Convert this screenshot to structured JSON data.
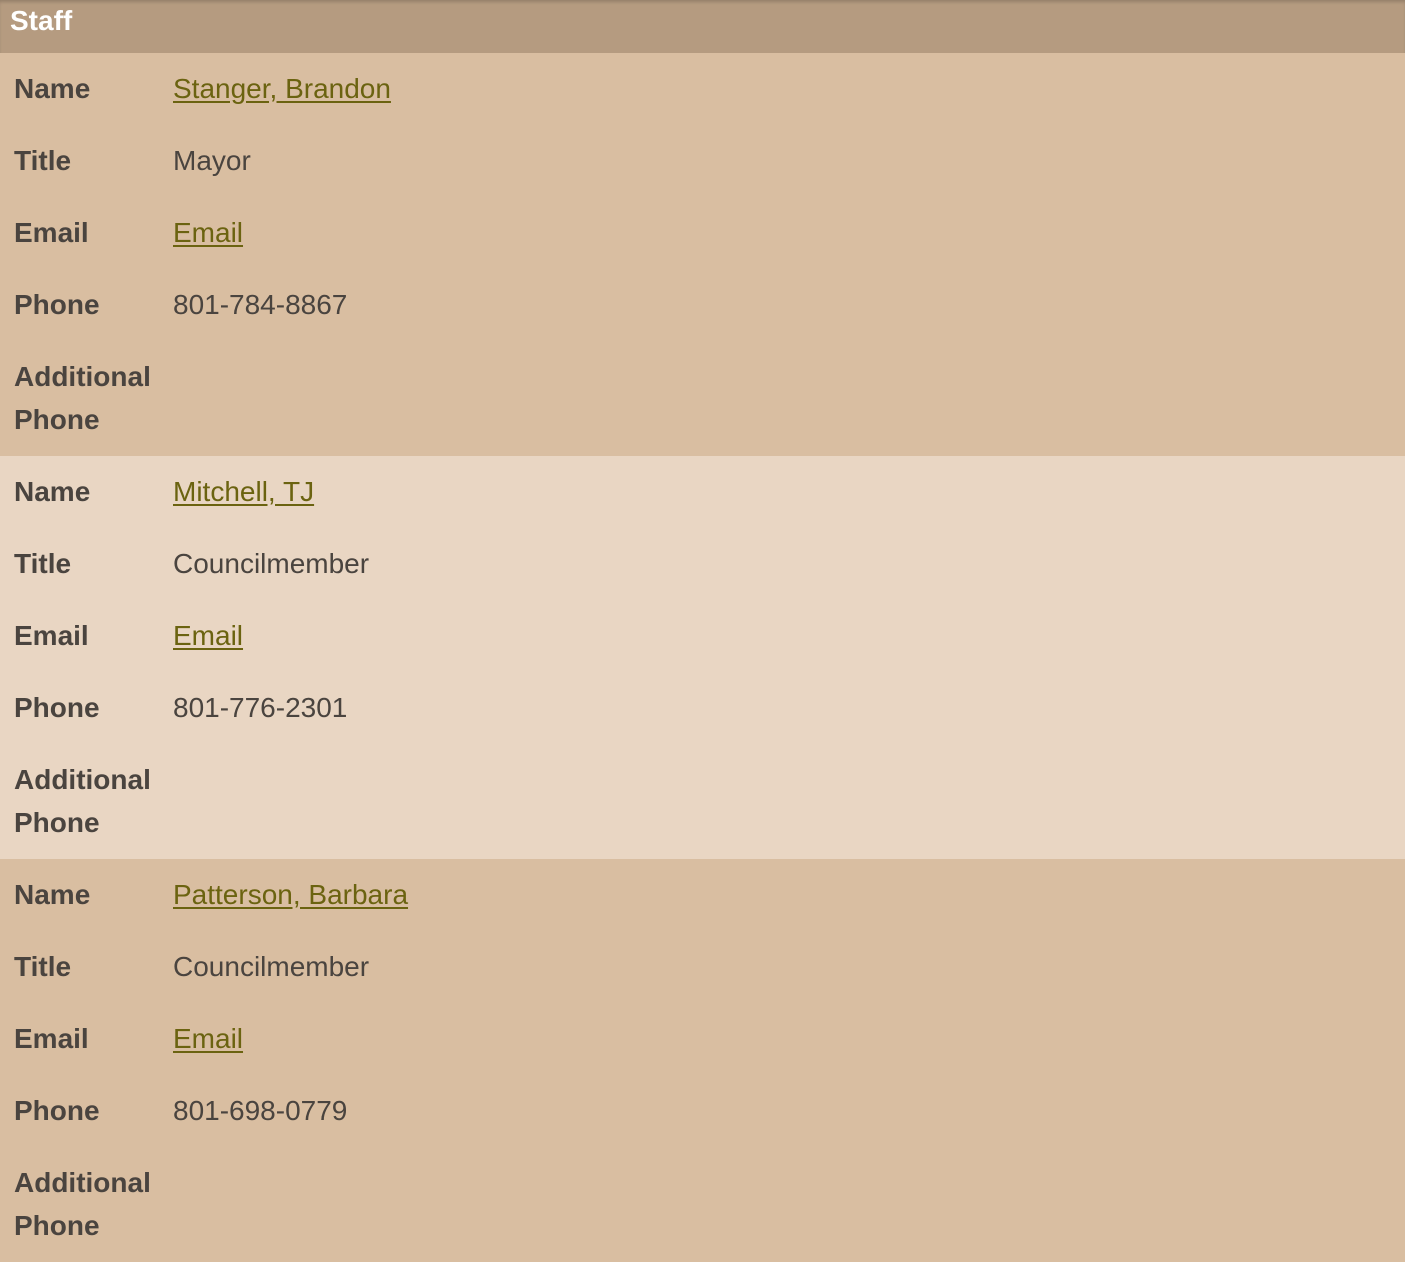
{
  "header": {
    "title": "Staff"
  },
  "labels": {
    "name": "Name",
    "title": "Title",
    "email": "Email",
    "phone": "Phone",
    "additional_phone": "Additional Phone"
  },
  "staff": [
    {
      "name": "Stanger, Brandon",
      "title": "Mayor",
      "email_link": "Email",
      "phone": "801-784-8867",
      "additional_phone": ""
    },
    {
      "name": "Mitchell, TJ",
      "title": "Councilmember",
      "email_link": "Email",
      "phone": "801-776-2301",
      "additional_phone": ""
    },
    {
      "name": "Patterson, Barbara",
      "title": "Councilmember",
      "email_link": "Email",
      "phone": "801-698-0779",
      "additional_phone": ""
    }
  ],
  "colors": {
    "header_bg": "#b59b80",
    "row_odd_bg": "#d9bea1",
    "row_even_bg": "#e9d6c3",
    "link": "#6b6310",
    "text": "#4a443f"
  }
}
